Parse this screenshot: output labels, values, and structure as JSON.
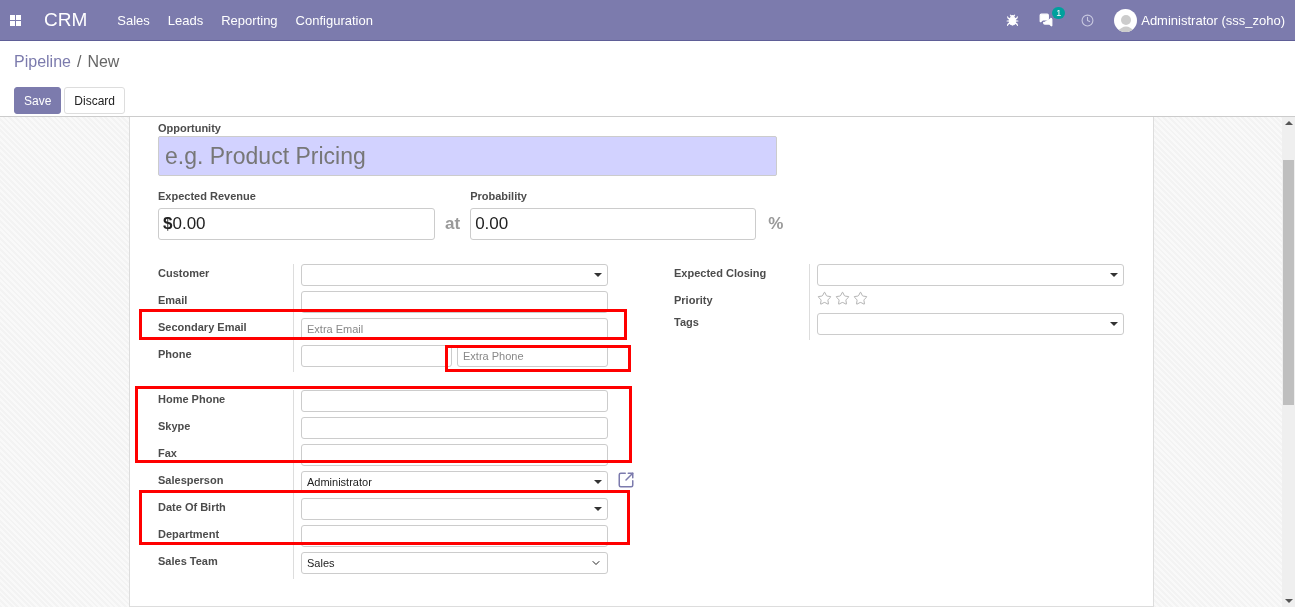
{
  "navbar": {
    "brand": "CRM",
    "menu": [
      "Sales",
      "Leads",
      "Reporting",
      "Configuration"
    ],
    "chat_count": "1",
    "user": "Administrator (sss_zoho)"
  },
  "breadcrumb": {
    "parent": "Pipeline",
    "separator": "/",
    "current": "New"
  },
  "buttons": [
    {
      "label": "Save",
      "kind": "primary"
    },
    {
      "label": "Discard",
      "kind": "secondary"
    }
  ],
  "form": {
    "opportunity": {
      "label": "Opportunity",
      "placeholder": "e.g. Product Pricing"
    },
    "revenue": {
      "label": "Expected Revenue",
      "currency": "$",
      "value": "0.00"
    },
    "at": "at",
    "probability": {
      "label": "Probability",
      "value": "0.00",
      "suffix": "%"
    },
    "left_groups": [
      {
        "fields": [
          {
            "label": "Customer",
            "kind": "select"
          },
          {
            "label": "Email",
            "kind": "input"
          },
          {
            "label": "Secondary Email",
            "kind": "input",
            "placeholder": "Extra Email"
          },
          {
            "label": "Phone",
            "kind": "phone",
            "placeholder": "Extra Phone"
          }
        ]
      },
      {
        "fields": [
          {
            "label": "Home Phone",
            "kind": "input"
          },
          {
            "label": "Skype",
            "kind": "input"
          },
          {
            "label": "Fax",
            "kind": "input"
          },
          {
            "label": "Salesperson",
            "kind": "select",
            "value": "Administrator",
            "external_link": true
          },
          {
            "label": "Date Of Birth",
            "kind": "select"
          },
          {
            "label": "Department",
            "kind": "input"
          },
          {
            "label": "Sales Team",
            "kind": "native_select",
            "value": "Sales"
          }
        ]
      }
    ],
    "right_fields": [
      {
        "label": "Expected Closing",
        "kind": "select"
      },
      {
        "label": "Priority",
        "kind": "stars",
        "stars": 0
      },
      {
        "label": "Tags",
        "kind": "select"
      }
    ]
  }
}
